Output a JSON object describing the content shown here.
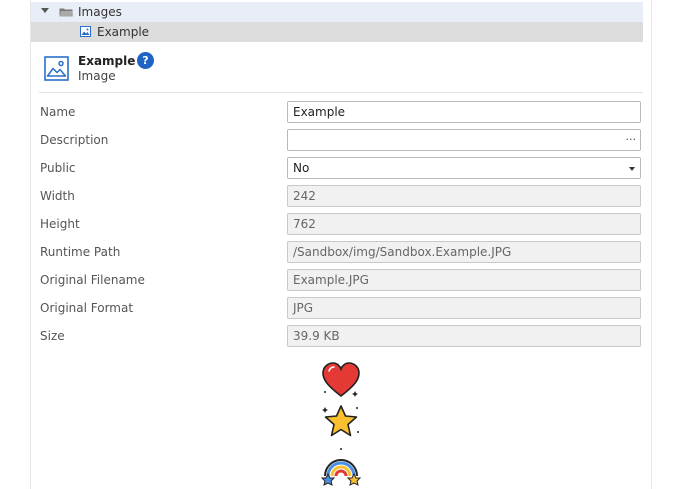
{
  "tree": {
    "folder_label": "Images",
    "item_label": "Example"
  },
  "header": {
    "title": "Example",
    "subtitle": "Image",
    "help_glyph": "?"
  },
  "properties": {
    "name": {
      "label": "Name",
      "value": "Example"
    },
    "description": {
      "label": "Description",
      "value": "",
      "ellipsis": "..."
    },
    "public": {
      "label": "Public",
      "value": "No"
    },
    "width": {
      "label": "Width",
      "value": "242"
    },
    "height": {
      "label": "Height",
      "value": "762"
    },
    "runtime_path": {
      "label": "Runtime Path",
      "value": "/Sandbox/img/Sandbox.Example.JPG"
    },
    "original_filename": {
      "label": "Original Filename",
      "value": "Example.JPG"
    },
    "original_format": {
      "label": "Original Format",
      "value": "JPG"
    },
    "size": {
      "label": "Size",
      "value": "39.9 KB"
    }
  },
  "colors": {
    "selection": "#e8edf8",
    "accent": "#1f64c4",
    "heart": "#e53935",
    "star": "#fbc02d"
  },
  "icons": {
    "folder": "folder-icon",
    "image": "image-icon",
    "help": "help-icon",
    "preview": [
      "heart-icon",
      "star-icon",
      "rainbow-icon"
    ]
  }
}
